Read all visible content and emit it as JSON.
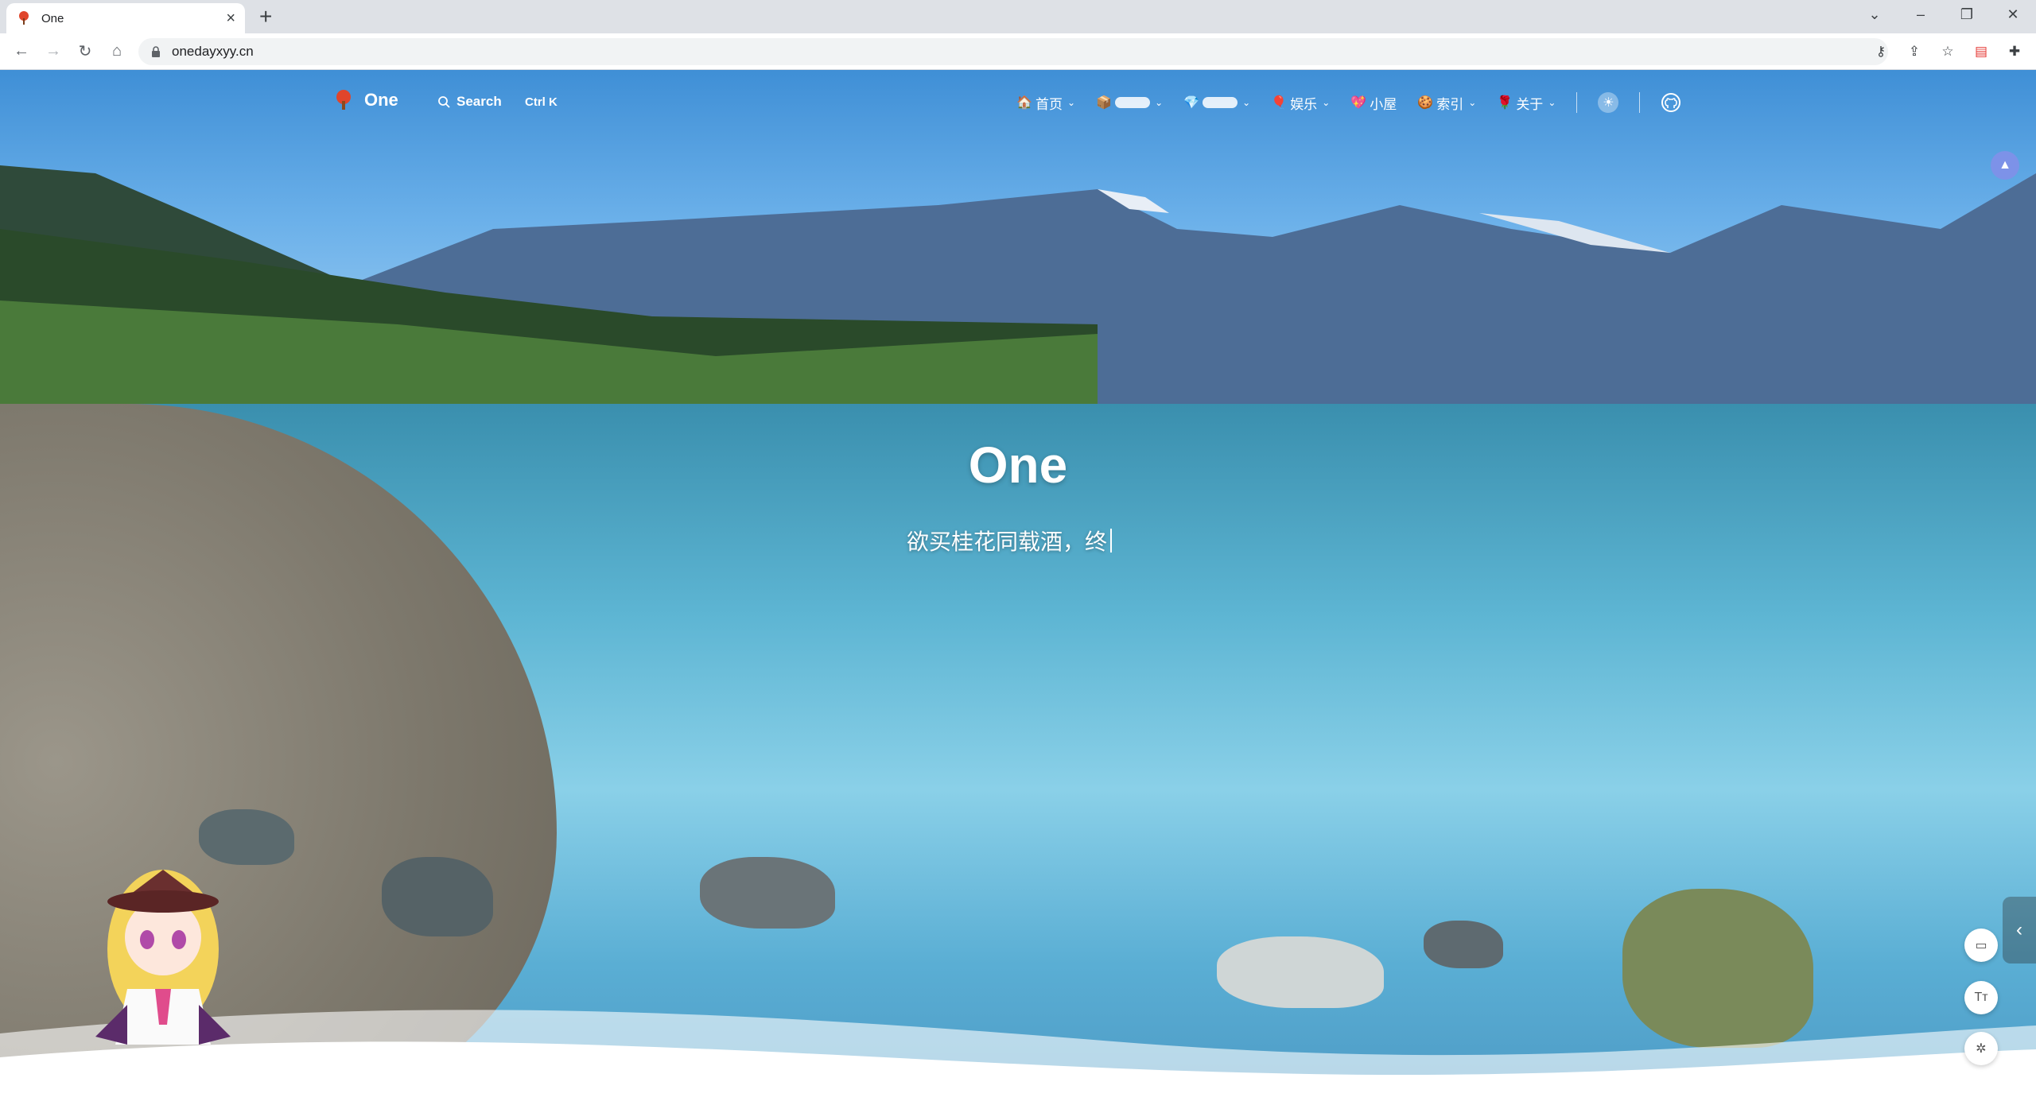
{
  "browser": {
    "tab_title": "One",
    "url": "onedayxyy.cn",
    "window_controls": [
      "chevron-down-icon",
      "minimize-icon",
      "restore-icon",
      "close-icon"
    ]
  },
  "site": {
    "logo_text": "One",
    "search_label": "Search",
    "search_shortcut": "Ctrl K",
    "menu": [
      {
        "icon": "house-emoji",
        "label": "首页",
        "has_dropdown": true
      },
      {
        "icon": "box-emoji",
        "label": "",
        "has_dropdown": true
      },
      {
        "icon": "gem-emoji",
        "label": "",
        "has_dropdown": true
      },
      {
        "icon": "balloon-emoji",
        "label": "娱乐",
        "has_dropdown": true
      },
      {
        "icon": "heart-emoji",
        "label": "小屋",
        "has_dropdown": false
      },
      {
        "icon": "cookie-emoji",
        "label": "索引",
        "has_dropdown": true
      },
      {
        "icon": "rose-emoji",
        "label": "关于",
        "has_dropdown": true
      }
    ],
    "hero": {
      "title": "One",
      "subtitle": "欲买桂花同载酒，终"
    }
  },
  "colors": {
    "browser_tabstrip": "#dee1e6",
    "notify_button": "#7d92e8",
    "text_on_hero": "#ffffff"
  }
}
